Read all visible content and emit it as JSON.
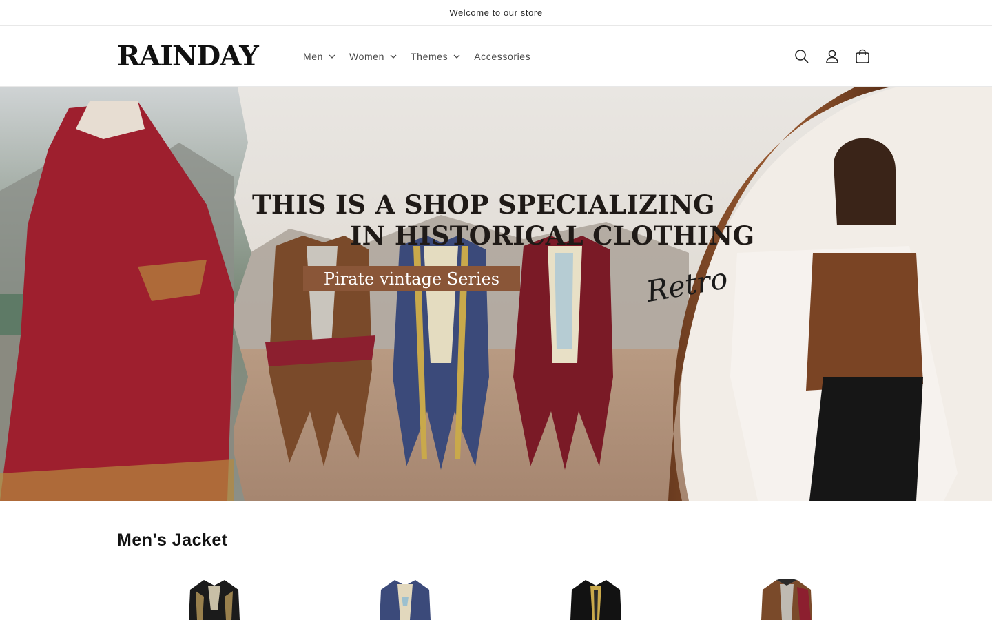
{
  "announcement": {
    "text": "Welcome to our store"
  },
  "header": {
    "logo": "RAINDAY",
    "nav": [
      {
        "label": "Men",
        "has_dropdown": true
      },
      {
        "label": "Women",
        "has_dropdown": true
      },
      {
        "label": "Themes",
        "has_dropdown": true
      },
      {
        "label": "Accessories",
        "has_dropdown": false
      }
    ],
    "icons": [
      "search-icon",
      "account-icon",
      "cart-icon"
    ]
  },
  "hero": {
    "title_line1": "THIS IS A SHOP SPECIALIZING",
    "title_line2": "IN HISTORICAL CLOTHING",
    "badge": "Pirate vintage Series",
    "script": "Retro",
    "colors": {
      "badge": "#8a5638",
      "dress": "#9e1f2e",
      "vest": "#6b3a1f"
    }
  },
  "section": {
    "title": "Men's Jacket",
    "products": [
      {
        "color": "#1b1b1b",
        "trim": "#b99a5a"
      },
      {
        "color": "#3b4a7a",
        "trim": "#d8cfa8"
      },
      {
        "color": "#121212",
        "trim": "#c9a94b"
      },
      {
        "color": "#7a4a2a",
        "trim": "#8c1f2f"
      }
    ]
  }
}
